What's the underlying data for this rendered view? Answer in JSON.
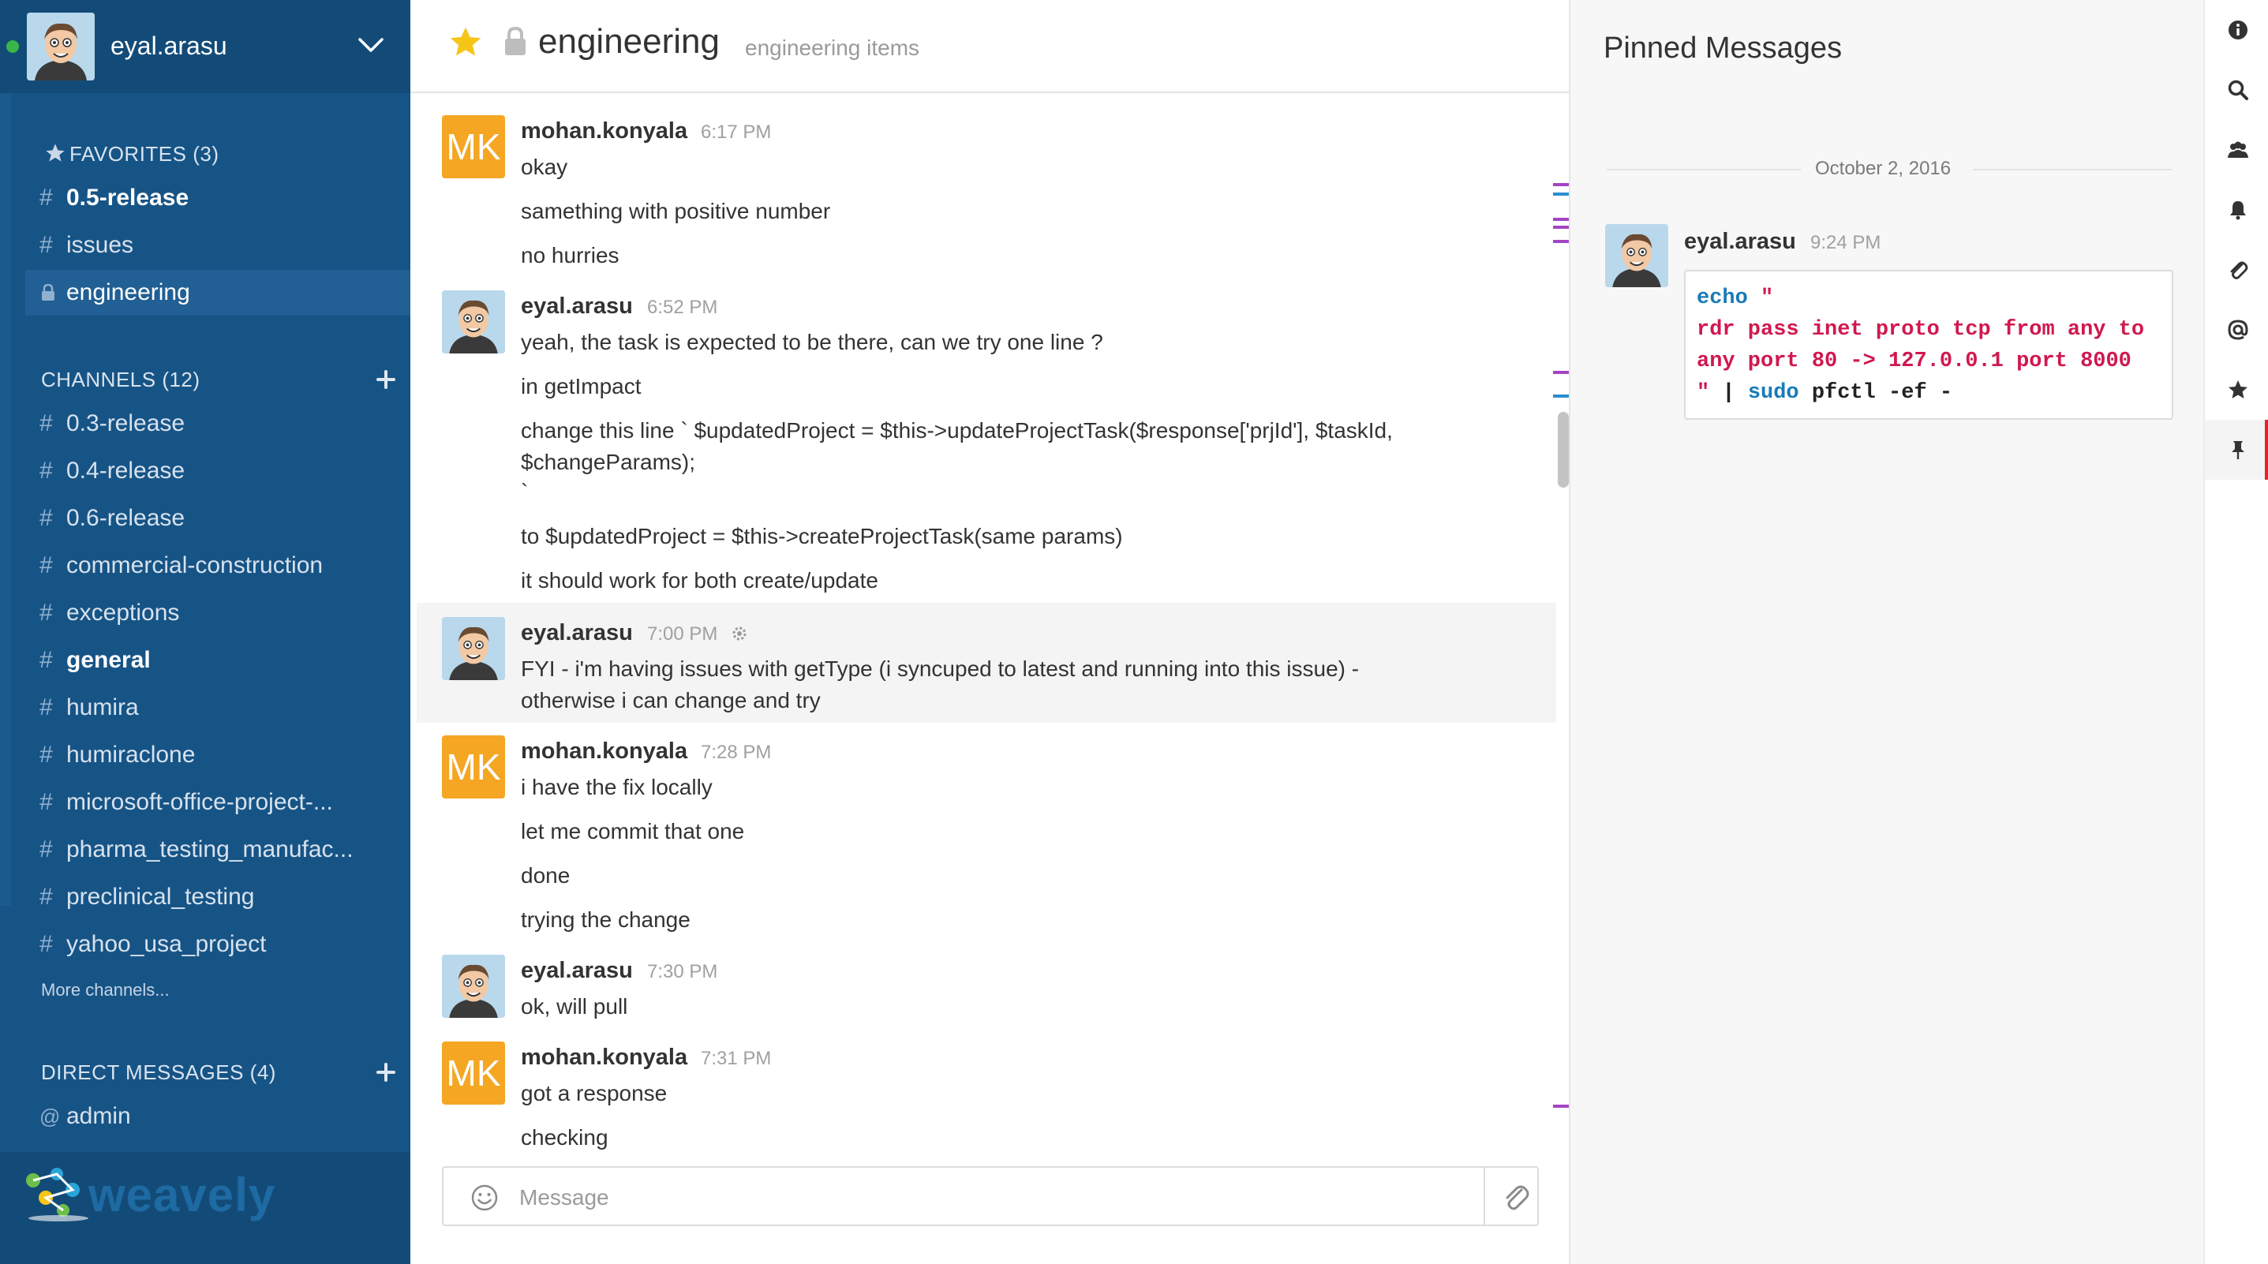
{
  "sidebar": {
    "username": "eyal.arasu",
    "favorites": {
      "title": "FAVORITES (3)",
      "items": [
        {
          "label": "0.5-release"
        },
        {
          "label": "issues"
        },
        {
          "label": "engineering"
        }
      ]
    },
    "channels": {
      "title": "CHANNELS (12)",
      "items": [
        {
          "label": "0.3-release"
        },
        {
          "label": "0.4-release"
        },
        {
          "label": "0.6-release"
        },
        {
          "label": "commercial-construction"
        },
        {
          "label": "exceptions"
        },
        {
          "label": "general"
        },
        {
          "label": "humira"
        },
        {
          "label": "humiraclone"
        },
        {
          "label": "microsoft-office-project-..."
        },
        {
          "label": "pharma_testing_manufac..."
        },
        {
          "label": "preclinical_testing"
        },
        {
          "label": "yahoo_usa_project"
        }
      ],
      "more": "More channels..."
    },
    "direct_messages": {
      "title": "DIRECT MESSAGES (4)",
      "items": [
        {
          "label": "admin",
          "prefix": "@"
        }
      ]
    },
    "brand": "weavely"
  },
  "channel": {
    "name": "engineering",
    "purpose": "engineering items"
  },
  "posts": [
    {
      "user": "mohan.konyala",
      "initials": "MK",
      "time": "6:17 PM",
      "lines": [
        "okay",
        "samething with positive number",
        "no hurries"
      ]
    },
    {
      "user": "eyal.arasu",
      "time": "6:52 PM",
      "lines": [
        "yeah, the task is expected to be there, can we try one line ?",
        "in getImpact",
        "change this line ` $updatedProject = $this->updateProjectTask($response['prjId'], $taskId,",
        "$changeParams);",
        "`",
        "to $updatedProject = $this->createProjectTask(same params)",
        "it should work for both create/update"
      ]
    },
    {
      "user": "eyal.arasu",
      "time": "7:00 PM",
      "lines": [
        "FYI - i'm having issues with getType (i syncuped to latest and running into this issue) -",
        "otherwise i can change and try"
      ]
    },
    {
      "user": "mohan.konyala",
      "initials": "MK",
      "time": "7:28 PM",
      "lines": [
        "i have the fix locally",
        "let me commit that one",
        "done",
        "trying the change"
      ]
    },
    {
      "user": "eyal.arasu",
      "time": "7:30 PM",
      "lines": [
        "ok, will pull"
      ]
    },
    {
      "user": "mohan.konyala",
      "initials": "MK",
      "time": "7:31 PM",
      "lines": [
        "got a response",
        "checking"
      ]
    }
  ],
  "composer": {
    "placeholder": "Message"
  },
  "pinned": {
    "title": "Pinned Messages",
    "date": "October 2, 2016",
    "user": "eyal.arasu",
    "time": "9:24 PM",
    "code": {
      "l1_kw": "echo",
      "l1_str": " \"",
      "l2": "rdr pass inet proto tcp from any to",
      "l3": "any port 80 -> 127.0.0.1 port 8000",
      "l4_str": "\"",
      "l4_pipe": " | ",
      "l4_kw": "sudo",
      "l4_rest": " pfctl -ef -"
    }
  },
  "rail": {
    "icons": [
      "info-icon",
      "search-icon",
      "members-icon",
      "bell-icon",
      "paperclip-icon",
      "at-icon",
      "star-icon",
      "pin-icon"
    ],
    "active": "pin-icon"
  },
  "colors": {
    "sidebar_bg": "#175486",
    "avatar_mk": "#f5a623",
    "favorite_star": "#f5c518",
    "active_marker": "#e2242a",
    "code_keyword": "#1a7bb8",
    "code_string": "#d0184e"
  }
}
